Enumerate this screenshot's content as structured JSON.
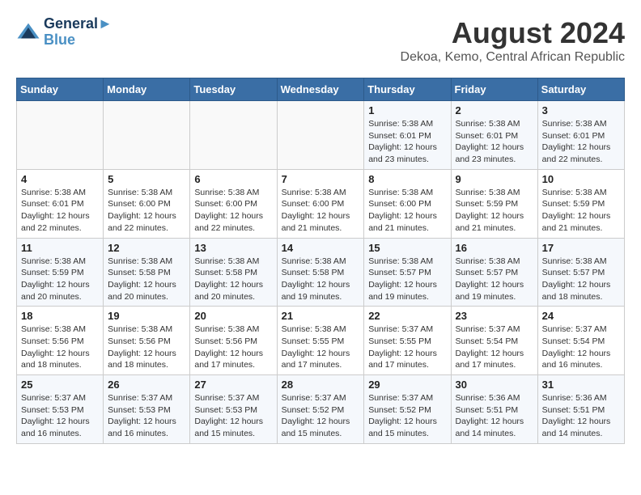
{
  "header": {
    "logo_line1": "General",
    "logo_line2": "Blue",
    "month": "August 2024",
    "location": "Dekoa, Kemo, Central African Republic"
  },
  "weekdays": [
    "Sunday",
    "Monday",
    "Tuesday",
    "Wednesday",
    "Thursday",
    "Friday",
    "Saturday"
  ],
  "weeks": [
    [
      {
        "day": "",
        "info": ""
      },
      {
        "day": "",
        "info": ""
      },
      {
        "day": "",
        "info": ""
      },
      {
        "day": "",
        "info": ""
      },
      {
        "day": "1",
        "info": "Sunrise: 5:38 AM\nSunset: 6:01 PM\nDaylight: 12 hours\nand 23 minutes."
      },
      {
        "day": "2",
        "info": "Sunrise: 5:38 AM\nSunset: 6:01 PM\nDaylight: 12 hours\nand 23 minutes."
      },
      {
        "day": "3",
        "info": "Sunrise: 5:38 AM\nSunset: 6:01 PM\nDaylight: 12 hours\nand 22 minutes."
      }
    ],
    [
      {
        "day": "4",
        "info": "Sunrise: 5:38 AM\nSunset: 6:01 PM\nDaylight: 12 hours\nand 22 minutes."
      },
      {
        "day": "5",
        "info": "Sunrise: 5:38 AM\nSunset: 6:00 PM\nDaylight: 12 hours\nand 22 minutes."
      },
      {
        "day": "6",
        "info": "Sunrise: 5:38 AM\nSunset: 6:00 PM\nDaylight: 12 hours\nand 22 minutes."
      },
      {
        "day": "7",
        "info": "Sunrise: 5:38 AM\nSunset: 6:00 PM\nDaylight: 12 hours\nand 21 minutes."
      },
      {
        "day": "8",
        "info": "Sunrise: 5:38 AM\nSunset: 6:00 PM\nDaylight: 12 hours\nand 21 minutes."
      },
      {
        "day": "9",
        "info": "Sunrise: 5:38 AM\nSunset: 5:59 PM\nDaylight: 12 hours\nand 21 minutes."
      },
      {
        "day": "10",
        "info": "Sunrise: 5:38 AM\nSunset: 5:59 PM\nDaylight: 12 hours\nand 21 minutes."
      }
    ],
    [
      {
        "day": "11",
        "info": "Sunrise: 5:38 AM\nSunset: 5:59 PM\nDaylight: 12 hours\nand 20 minutes."
      },
      {
        "day": "12",
        "info": "Sunrise: 5:38 AM\nSunset: 5:58 PM\nDaylight: 12 hours\nand 20 minutes."
      },
      {
        "day": "13",
        "info": "Sunrise: 5:38 AM\nSunset: 5:58 PM\nDaylight: 12 hours\nand 20 minutes."
      },
      {
        "day": "14",
        "info": "Sunrise: 5:38 AM\nSunset: 5:58 PM\nDaylight: 12 hours\nand 19 minutes."
      },
      {
        "day": "15",
        "info": "Sunrise: 5:38 AM\nSunset: 5:57 PM\nDaylight: 12 hours\nand 19 minutes."
      },
      {
        "day": "16",
        "info": "Sunrise: 5:38 AM\nSunset: 5:57 PM\nDaylight: 12 hours\nand 19 minutes."
      },
      {
        "day": "17",
        "info": "Sunrise: 5:38 AM\nSunset: 5:57 PM\nDaylight: 12 hours\nand 18 minutes."
      }
    ],
    [
      {
        "day": "18",
        "info": "Sunrise: 5:38 AM\nSunset: 5:56 PM\nDaylight: 12 hours\nand 18 minutes."
      },
      {
        "day": "19",
        "info": "Sunrise: 5:38 AM\nSunset: 5:56 PM\nDaylight: 12 hours\nand 18 minutes."
      },
      {
        "day": "20",
        "info": "Sunrise: 5:38 AM\nSunset: 5:56 PM\nDaylight: 12 hours\nand 17 minutes."
      },
      {
        "day": "21",
        "info": "Sunrise: 5:38 AM\nSunset: 5:55 PM\nDaylight: 12 hours\nand 17 minutes."
      },
      {
        "day": "22",
        "info": "Sunrise: 5:37 AM\nSunset: 5:55 PM\nDaylight: 12 hours\nand 17 minutes."
      },
      {
        "day": "23",
        "info": "Sunrise: 5:37 AM\nSunset: 5:54 PM\nDaylight: 12 hours\nand 17 minutes."
      },
      {
        "day": "24",
        "info": "Sunrise: 5:37 AM\nSunset: 5:54 PM\nDaylight: 12 hours\nand 16 minutes."
      }
    ],
    [
      {
        "day": "25",
        "info": "Sunrise: 5:37 AM\nSunset: 5:53 PM\nDaylight: 12 hours\nand 16 minutes."
      },
      {
        "day": "26",
        "info": "Sunrise: 5:37 AM\nSunset: 5:53 PM\nDaylight: 12 hours\nand 16 minutes."
      },
      {
        "day": "27",
        "info": "Sunrise: 5:37 AM\nSunset: 5:53 PM\nDaylight: 12 hours\nand 15 minutes."
      },
      {
        "day": "28",
        "info": "Sunrise: 5:37 AM\nSunset: 5:52 PM\nDaylight: 12 hours\nand 15 minutes."
      },
      {
        "day": "29",
        "info": "Sunrise: 5:37 AM\nSunset: 5:52 PM\nDaylight: 12 hours\nand 15 minutes."
      },
      {
        "day": "30",
        "info": "Sunrise: 5:36 AM\nSunset: 5:51 PM\nDaylight: 12 hours\nand 14 minutes."
      },
      {
        "day": "31",
        "info": "Sunrise: 5:36 AM\nSunset: 5:51 PM\nDaylight: 12 hours\nand 14 minutes."
      }
    ]
  ]
}
